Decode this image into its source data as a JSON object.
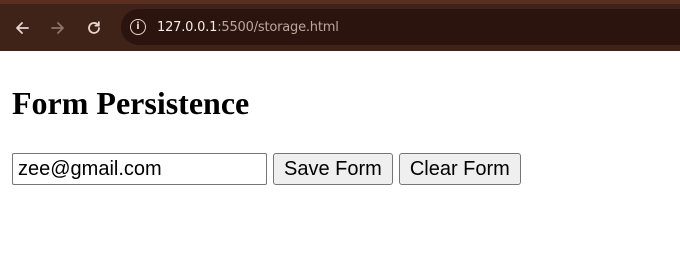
{
  "browser": {
    "url_host": "127.0.0.1",
    "url_rest": ":5500/storage.html",
    "icons": {
      "back": "arrow-left-icon",
      "forward": "arrow-right-icon",
      "reload": "reload-icon",
      "site_info": "info-icon"
    }
  },
  "page": {
    "heading": "Form Persistence",
    "form": {
      "email_value": "zee@gmail.com",
      "save_label": "Save Form",
      "clear_label": "Clear Form"
    }
  },
  "colors": {
    "toolbar_bg": "#3f2218",
    "omnibox_bg": "#2a140d",
    "button_bg": "#efefef"
  }
}
